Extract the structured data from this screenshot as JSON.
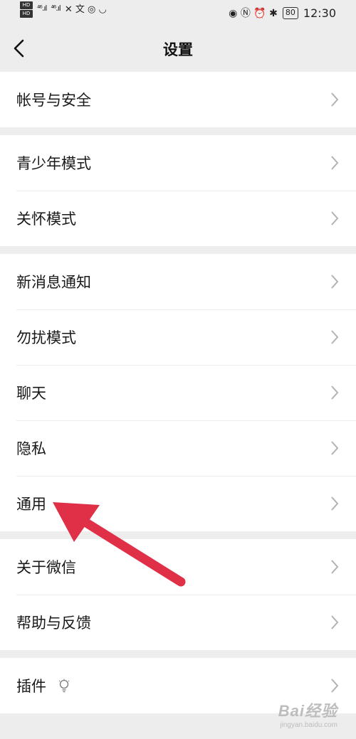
{
  "status_bar": {
    "hd_top": "HD",
    "hd_bottom": "HD",
    "signal_1": "⁴⁶.ıl",
    "signal_2": "⁴⁶.ıl",
    "left_icons": "✕ 文 ◎ ◡",
    "right_icons": "◉ Ⓝ ⏰ ✱",
    "battery": "80",
    "time": "12:30"
  },
  "nav": {
    "title": "设置",
    "back_icon": "chevron-left-icon"
  },
  "groups": [
    {
      "items": [
        {
          "label": "帐号与安全"
        }
      ]
    },
    {
      "items": [
        {
          "label": "青少年模式"
        },
        {
          "label": "关怀模式"
        }
      ]
    },
    {
      "items": [
        {
          "label": "新消息通知"
        },
        {
          "label": "勿扰模式"
        },
        {
          "label": "聊天"
        },
        {
          "label": "隐私"
        },
        {
          "label": "通用"
        }
      ]
    },
    {
      "items": [
        {
          "label": "关于微信"
        },
        {
          "label": "帮助与反馈"
        }
      ]
    },
    {
      "items": [
        {
          "label": "插件"
        }
      ]
    }
  ],
  "annotation": {
    "arrow_color": "#e03048"
  },
  "watermark": {
    "main": "Bai经验",
    "sub": "jingyan.baidu.com"
  },
  "colors": {
    "background": "#ededed",
    "row_bg": "#ffffff",
    "chevron": "#b2b2b2"
  }
}
